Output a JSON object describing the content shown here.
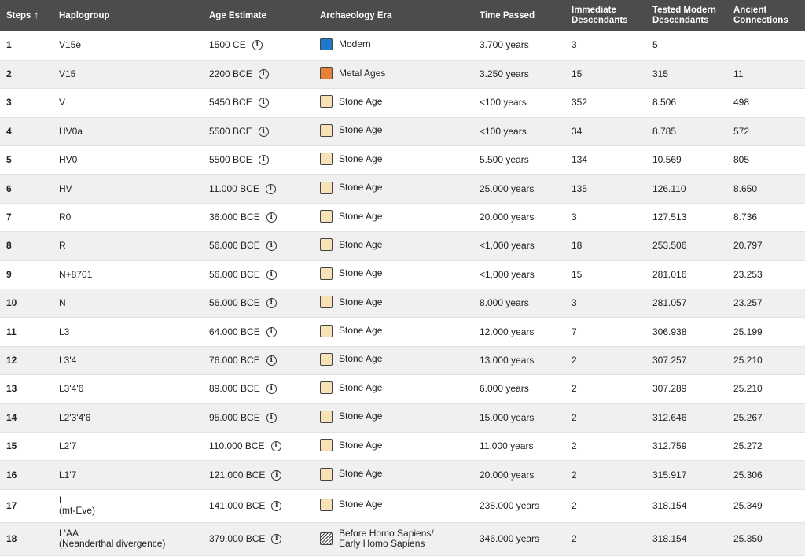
{
  "headers": {
    "steps": "Steps",
    "sort_arrow": "↑",
    "haplogroup": "Haplogroup",
    "age": "Age Estimate",
    "era": "Archaeology Era",
    "time": "Time Passed",
    "immediate": "Immediate Descendants",
    "tested": "Tested Modern Descendants",
    "ancient": "Ancient Connections"
  },
  "era_colors": {
    "Modern": "#1f78c8",
    "Metal Ages": "#e8803a",
    "Stone Age": "#f6e2b4",
    "Before": "hatched"
  },
  "rows": [
    {
      "step": "1",
      "haplo": "V15e",
      "haplo_sub": "",
      "age": "1500 CE",
      "era": "Modern",
      "era_sub": "",
      "swatch": "#1f78c8",
      "time": "3.700 years",
      "immediate": "3",
      "tested": "5",
      "ancient": ""
    },
    {
      "step": "2",
      "haplo": "V15",
      "haplo_sub": "",
      "age": "2200 BCE",
      "era": "Metal Ages",
      "era_sub": "",
      "swatch": "#e8803a",
      "time": "3.250 years",
      "immediate": "15",
      "tested": "315",
      "ancient": "11"
    },
    {
      "step": "3",
      "haplo": "V",
      "haplo_sub": "",
      "age": "5450 BCE",
      "era": "Stone Age",
      "era_sub": "",
      "swatch": "#f6e2b4",
      "time": "<100 years",
      "immediate": "352",
      "tested": "8.506",
      "ancient": "498"
    },
    {
      "step": "4",
      "haplo": "HV0a",
      "haplo_sub": "",
      "age": "5500 BCE",
      "era": "Stone Age",
      "era_sub": "",
      "swatch": "#f6e2b4",
      "time": "<100 years",
      "immediate": "34",
      "tested": "8.785",
      "ancient": "572"
    },
    {
      "step": "5",
      "haplo": "HV0",
      "haplo_sub": "",
      "age": "5500 BCE",
      "era": "Stone Age",
      "era_sub": "",
      "swatch": "#f6e2b4",
      "time": "5.500 years",
      "immediate": "134",
      "tested": "10.569",
      "ancient": "805"
    },
    {
      "step": "6",
      "haplo": "HV",
      "haplo_sub": "",
      "age": "11.000 BCE",
      "era": "Stone Age",
      "era_sub": "",
      "swatch": "#f6e2b4",
      "time": "25.000 years",
      "immediate": "135",
      "tested": "126.110",
      "ancient": "8.650"
    },
    {
      "step": "7",
      "haplo": "R0",
      "haplo_sub": "",
      "age": "36.000 BCE",
      "era": "Stone Age",
      "era_sub": "",
      "swatch": "#f6e2b4",
      "time": "20.000 years",
      "immediate": "3",
      "tested": "127.513",
      "ancient": "8.736"
    },
    {
      "step": "8",
      "haplo": "R",
      "haplo_sub": "",
      "age": "56.000 BCE",
      "era": "Stone Age",
      "era_sub": "",
      "swatch": "#f6e2b4",
      "time": "<1,000 years",
      "immediate": "18",
      "tested": "253.506",
      "ancient": "20.797"
    },
    {
      "step": "9",
      "haplo": "N+8701",
      "haplo_sub": "",
      "age": "56.000 BCE",
      "era": "Stone Age",
      "era_sub": "",
      "swatch": "#f6e2b4",
      "time": "<1,000 years",
      "immediate": "15",
      "tested": "281.016",
      "ancient": "23.253"
    },
    {
      "step": "10",
      "haplo": "N",
      "haplo_sub": "",
      "age": "56.000 BCE",
      "era": "Stone Age",
      "era_sub": "",
      "swatch": "#f6e2b4",
      "time": "8.000 years",
      "immediate": "3",
      "tested": "281.057",
      "ancient": "23.257"
    },
    {
      "step": "11",
      "haplo": "L3",
      "haplo_sub": "",
      "age": "64.000 BCE",
      "era": "Stone Age",
      "era_sub": "",
      "swatch": "#f6e2b4",
      "time": "12.000 years",
      "immediate": "7",
      "tested": "306.938",
      "ancient": "25.199"
    },
    {
      "step": "12",
      "haplo": "L3'4",
      "haplo_sub": "",
      "age": "76.000 BCE",
      "era": "Stone Age",
      "era_sub": "",
      "swatch": "#f6e2b4",
      "time": "13.000 years",
      "immediate": "2",
      "tested": "307.257",
      "ancient": "25.210"
    },
    {
      "step": "13",
      "haplo": "L3'4'6",
      "haplo_sub": "",
      "age": "89.000 BCE",
      "era": "Stone Age",
      "era_sub": "",
      "swatch": "#f6e2b4",
      "time": "6.000 years",
      "immediate": "2",
      "tested": "307.289",
      "ancient": "25.210"
    },
    {
      "step": "14",
      "haplo": "L2'3'4'6",
      "haplo_sub": "",
      "age": "95.000 BCE",
      "era": "Stone Age",
      "era_sub": "",
      "swatch": "#f6e2b4",
      "time": "15.000 years",
      "immediate": "2",
      "tested": "312.646",
      "ancient": "25.267"
    },
    {
      "step": "15",
      "haplo": "L2'7",
      "haplo_sub": "",
      "age": "110.000 BCE",
      "era": "Stone Age",
      "era_sub": "",
      "swatch": "#f6e2b4",
      "time": "11.000 years",
      "immediate": "2",
      "tested": "312.759",
      "ancient": "25.272"
    },
    {
      "step": "16",
      "haplo": "L1'7",
      "haplo_sub": "",
      "age": "121.000 BCE",
      "era": "Stone Age",
      "era_sub": "",
      "swatch": "#f6e2b4",
      "time": "20.000 years",
      "immediate": "2",
      "tested": "315.917",
      "ancient": "25.306"
    },
    {
      "step": "17",
      "haplo": "L",
      "haplo_sub": "(mt-Eve)",
      "age": "141.000 BCE",
      "era": "Stone Age",
      "era_sub": "",
      "swatch": "#f6e2b4",
      "time": "238.000 years",
      "immediate": "2",
      "tested": "318.154",
      "ancient": "25.349"
    },
    {
      "step": "18",
      "haplo": "L'AA",
      "haplo_sub": "(Neanderthal divergence)",
      "age": "379.000 BCE",
      "era": "Before Homo Sapiens/",
      "era_sub": "Early Homo Sapiens",
      "swatch": "hatched",
      "time": "346.000 years",
      "immediate": "2",
      "tested": "318.154",
      "ancient": "25.350"
    }
  ]
}
